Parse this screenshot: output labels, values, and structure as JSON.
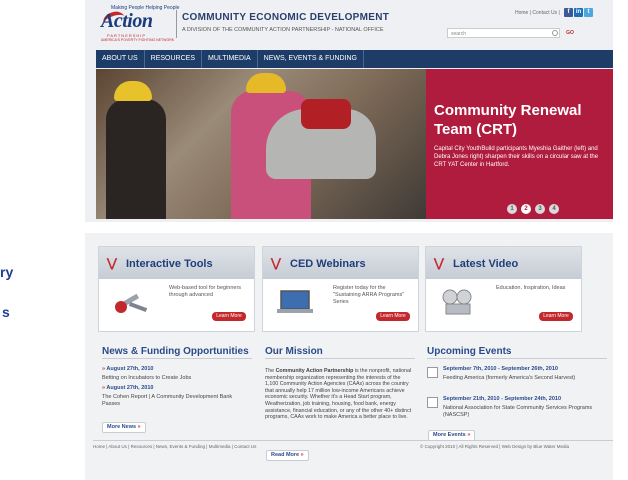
{
  "left_fragments": [
    "ry",
    "s"
  ],
  "header": {
    "logo_top": "Making People Helping People",
    "logo_name": "Action",
    "logo_sub": "PARTNERSHIP",
    "logo_tag": "AMERICA'S POVERTY FIGHTING NETWORK",
    "title": "COMMUNITY  ECONOMIC DEVELOPMENT",
    "subtitle": "A DIVISION OF THE COMMUNITY ACTION PARTNERSHIP - NATIONAL OFFICE",
    "toplinks": "Home | Contact Us |",
    "search_placeholder": "search",
    "go_label": "GO"
  },
  "nav": [
    "ABOUT US",
    "RESOURCES",
    "MULTIMEDIA",
    "NEWS, EVENTS & FUNDING"
  ],
  "hero": {
    "title": "Community Renewal Team (CRT)",
    "text": "Capital City YouthBuild participants Myeshia Gaither (left) and Debra Jones right) sharpen their skills on a circular saw at the CRT YAT Center in Hartford.",
    "dots": [
      "1",
      "2",
      "3",
      "4"
    ],
    "active_dot": 1
  },
  "features": [
    {
      "title": "Interactive Tools",
      "text": "Web-based tool for beginners through advanced",
      "button": "Learn More"
    },
    {
      "title": "CED Webinars",
      "text": "Register today for the \"Sustaining ARRA Programs\" Series",
      "button": "Learn More"
    },
    {
      "title": "Latest Video",
      "text": "Education, Inspiration, Ideas",
      "button": "Learn More"
    }
  ],
  "news": {
    "title": "News & Funding Opportunities",
    "items": [
      {
        "date": "August 27th, 2010",
        "text": "Betting on Incubators to Create Jobs"
      },
      {
        "date": "August 27th, 2010",
        "text": "The Cohen Report | A Community Development Bank Passes"
      }
    ],
    "more": "More News"
  },
  "mission": {
    "title": "Our Mission",
    "text_lead": "The ",
    "text_strong": "Community Action Partnership",
    "text_rest": " is the nonprofit, national membership organization representing the interests of the 1,100 Community Action Agencies (CAAs) across the country that annually help 17 million low-income Americans achieve economic security. Whether it's a Head Start program, Weatherization, job training, housing, food bank, energy assistance, financial education, or any of the other 40+ distinct programs, CAAs work to make America a better place to live.",
    "more": "Read More"
  },
  "events": {
    "title": "Upcoming Events",
    "items": [
      {
        "date": "September 7th, 2010 - September 26th, 2010",
        "text": "Feeding America (formerly America's Second Harvest)"
      },
      {
        "date": "September 21th, 2010 - September 24th, 2010",
        "text": "National Association for State Community Services Programs (NASCSP)"
      }
    ],
    "more": "More Events"
  },
  "footer": {
    "left": "Home | About Us | Resources | News, Events & Funding | Multimedia | Contact Us",
    "right": "© Copyright 2010 | All Rights Reserved | Web Design by Blue Water Media"
  },
  "colors": {
    "navy": "#1d3d68",
    "accent_red": "#b01c3e",
    "link_blue": "#2a4a8a"
  }
}
